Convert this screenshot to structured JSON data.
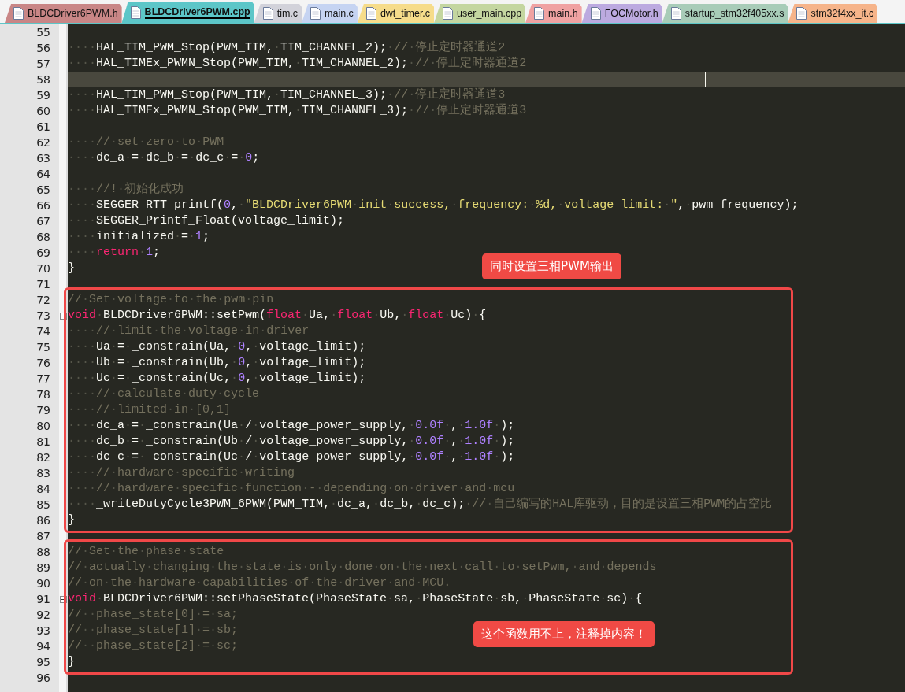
{
  "tabs": [
    {
      "label": "BLDCDriver6PWM.h",
      "selected": false,
      "color": "#c98686"
    },
    {
      "label": "BLDCDriver6PWM.cpp",
      "selected": true,
      "color": "#5cc6c8"
    },
    {
      "label": "tim.c",
      "selected": false,
      "color": "#d2d2da"
    },
    {
      "label": "main.c",
      "selected": false,
      "color": "#c6d4f2"
    },
    {
      "label": "dwt_timer.c",
      "selected": false,
      "color": "#f6dc8a"
    },
    {
      "label": "user_main.cpp",
      "selected": false,
      "color": "#c4d6a0"
    },
    {
      "label": "main.h",
      "selected": false,
      "color": "#f0a2a2"
    },
    {
      "label": "FOCMotor.h",
      "selected": false,
      "color": "#bcaae0"
    },
    {
      "label": "startup_stm32f405xx.s",
      "selected": false,
      "color": "#a8ccb8"
    },
    {
      "label": "stm32f4xx_it.c",
      "selected": false,
      "color": "#f6b48a"
    }
  ],
  "editor": {
    "sections": [
      {
        "kind": "plain",
        "lines": [
          {
            "number": "55"
          },
          {
            "number": "56",
            "tokens": [
              {
                "text": "····HAL_TIM_PWM_Stop(PWM_TIM,·TIM_CHANNEL_2);·",
                "kind": "plain"
              },
              {
                "text": "//·停止定时器通道2",
                "kind": "comment"
              }
            ]
          },
          {
            "number": "57",
            "tokens": [
              {
                "text": "····HAL_TIMEx_PWMN_Stop(PWM_TIM,·TIM_CHANNEL_2);·",
                "kind": "plain"
              },
              {
                "text": "//·停止定时器通道2",
                "kind": "comment"
              }
            ]
          },
          {
            "number": "58",
            "current": true
          },
          {
            "number": "59",
            "tokens": [
              {
                "text": "····HAL_TIM_PWM_Stop(PWM_TIM,·TIM_CHANNEL_3);·",
                "kind": "plain"
              },
              {
                "text": "//·停止定时器通道3",
                "kind": "comment"
              }
            ]
          },
          {
            "number": "60",
            "tokens": [
              {
                "text": "····HAL_TIMEx_PWMN_Stop(PWM_TIM,·TIM_CHANNEL_3);·",
                "kind": "plain"
              },
              {
                "text": "//·停止定时器通道3",
                "kind": "comment"
              }
            ]
          },
          {
            "number": "61"
          },
          {
            "number": "62",
            "tokens": [
              {
                "text": "····//·set·zero·to·PWM",
                "kind": "comment"
              }
            ]
          },
          {
            "number": "63",
            "tokens": [
              {
                "text": "····dc_a·=·dc_b·=·dc_c·=·",
                "kind": "plain"
              },
              {
                "text": "0",
                "kind": "number"
              },
              {
                "text": ";",
                "kind": "plain"
              }
            ]
          },
          {
            "number": "64"
          },
          {
            "number": "65",
            "tokens": [
              {
                "text": "····//!·初始化成功",
                "kind": "comment"
              }
            ]
          },
          {
            "number": "66",
            "tokens": [
              {
                "text": "····SEGGER_RTT_printf(",
                "kind": "plain"
              },
              {
                "text": "0",
                "kind": "number"
              },
              {
                "text": ",·",
                "kind": "plain"
              },
              {
                "text": "\"BLDCDriver6PWM·init·success,·frequency:·%d,·voltage_limit:·\"",
                "kind": "string"
              },
              {
                "text": ",·pwm_frequency);",
                "kind": "plain"
              }
            ]
          },
          {
            "number": "67",
            "tokens": [
              {
                "text": "····SEGGER_Printf_Float(voltage_limit);",
                "kind": "plain"
              }
            ]
          },
          {
            "number": "68",
            "tokens": [
              {
                "text": "····initialized·=·",
                "kind": "plain"
              },
              {
                "text": "1",
                "kind": "number"
              },
              {
                "text": ";",
                "kind": "plain"
              }
            ]
          },
          {
            "number": "69",
            "tokens": [
              {
                "text": "····",
                "kind": "plain"
              },
              {
                "text": "return",
                "kind": "keyword"
              },
              {
                "text": "·",
                "kind": "plain"
              },
              {
                "text": "1",
                "kind": "number"
              },
              {
                "text": ";",
                "kind": "plain"
              }
            ]
          },
          {
            "number": "70",
            "tokens": [
              {
                "text": "}",
                "kind": "plain"
              }
            ]
          },
          {
            "number": "71"
          }
        ]
      },
      {
        "kind": "frame",
        "lines": [
          {
            "number": "72",
            "tokens": [
              {
                "text": "//·Set·voltage·to·the·pwm·pin",
                "kind": "comment"
              }
            ]
          },
          {
            "number": "73",
            "fold": true,
            "tokens": [
              {
                "text": "void",
                "kind": "keyword"
              },
              {
                "text": "·BLDCDriver6PWM::setPwm(",
                "kind": "plain"
              },
              {
                "text": "float",
                "kind": "keyword"
              },
              {
                "text": "·Ua,·",
                "kind": "plain"
              },
              {
                "text": "float",
                "kind": "keyword"
              },
              {
                "text": "·Ub,·",
                "kind": "plain"
              },
              {
                "text": "float",
                "kind": "keyword"
              },
              {
                "text": "·Uc)·{",
                "kind": "plain"
              }
            ]
          },
          {
            "number": "74",
            "tokens": [
              {
                "text": "····//·limit·the·voltage·in·driver",
                "kind": "comment"
              }
            ]
          },
          {
            "number": "75",
            "tokens": [
              {
                "text": "····Ua·=·_constrain(Ua,·",
                "kind": "plain"
              },
              {
                "text": "0",
                "kind": "number"
              },
              {
                "text": ",·voltage_limit);",
                "kind": "plain"
              }
            ]
          },
          {
            "number": "76",
            "tokens": [
              {
                "text": "····Ub·=·_constrain(Ub,·",
                "kind": "plain"
              },
              {
                "text": "0",
                "kind": "number"
              },
              {
                "text": ",·voltage_limit);",
                "kind": "plain"
              }
            ]
          },
          {
            "number": "77",
            "tokens": [
              {
                "text": "····Uc·=·_constrain(Uc,·",
                "kind": "plain"
              },
              {
                "text": "0",
                "kind": "number"
              },
              {
                "text": ",·voltage_limit);",
                "kind": "plain"
              }
            ]
          },
          {
            "number": "78",
            "tokens": [
              {
                "text": "····//·calculate·duty·cycle",
                "kind": "comment"
              }
            ]
          },
          {
            "number": "79",
            "tokens": [
              {
                "text": "····//·limited·in·[0,1]",
                "kind": "comment"
              }
            ]
          },
          {
            "number": "80",
            "tokens": [
              {
                "text": "····dc_a·=·_constrain(Ua·/·voltage_power_supply,·",
                "kind": "plain"
              },
              {
                "text": "0.0f",
                "kind": "number"
              },
              {
                "text": "·,·",
                "kind": "plain"
              },
              {
                "text": "1.0f",
                "kind": "number"
              },
              {
                "text": "·);",
                "kind": "plain"
              }
            ]
          },
          {
            "number": "81",
            "tokens": [
              {
                "text": "····dc_b·=·_constrain(Ub·/·voltage_power_supply,·",
                "kind": "plain"
              },
              {
                "text": "0.0f",
                "kind": "number"
              },
              {
                "text": "·,·",
                "kind": "plain"
              },
              {
                "text": "1.0f",
                "kind": "number"
              },
              {
                "text": "·);",
                "kind": "plain"
              }
            ]
          },
          {
            "number": "82",
            "tokens": [
              {
                "text": "····dc_c·=·_constrain(Uc·/·voltage_power_supply,·",
                "kind": "plain"
              },
              {
                "text": "0.0f",
                "kind": "number"
              },
              {
                "text": "·,·",
                "kind": "plain"
              },
              {
                "text": "1.0f",
                "kind": "number"
              },
              {
                "text": "·);",
                "kind": "plain"
              }
            ]
          },
          {
            "number": "83",
            "tokens": [
              {
                "text": "····//·hardware·specific·writing",
                "kind": "comment"
              }
            ]
          },
          {
            "number": "84",
            "tokens": [
              {
                "text": "····//·hardware·specific·function·-·depending·on·driver·and·mcu",
                "kind": "comment"
              }
            ]
          },
          {
            "number": "85",
            "tokens": [
              {
                "text": "····_writeDutyCycle3PWM_6PWM(PWM_TIM,·dc_a,·dc_b,·dc_c);·",
                "kind": "plain"
              },
              {
                "text": "//·自己编写的HAL库驱动，目的是设置三相PWM的占空比",
                "kind": "comment"
              }
            ]
          },
          {
            "number": "86",
            "tokens": [
              {
                "text": "}",
                "kind": "plain"
              }
            ]
          }
        ]
      },
      {
        "kind": "plain",
        "lines": [
          {
            "number": "87"
          }
        ]
      },
      {
        "kind": "frame",
        "lines": [
          {
            "number": "88",
            "tokens": [
              {
                "text": "//·Set·the·phase·state",
                "kind": "comment"
              }
            ]
          },
          {
            "number": "89",
            "tokens": [
              {
                "text": "//·actually·changing·the·state·is·only·done·on·the·next·call·to·setPwm,·and·depends",
                "kind": "comment"
              }
            ]
          },
          {
            "number": "90",
            "tokens": [
              {
                "text": "//·on·the·hardware·capabilities·of·the·driver·and·MCU.",
                "kind": "comment"
              }
            ]
          },
          {
            "number": "91",
            "fold": true,
            "tokens": [
              {
                "text": "void",
                "kind": "keyword"
              },
              {
                "text": "·BLDCDriver6PWM::setPhaseState(PhaseState·sa,·PhaseState·sb,·PhaseState·sc)·{",
                "kind": "plain"
              }
            ]
          },
          {
            "number": "92",
            "tokens": [
              {
                "text": "//··phase_state[0]·=·sa;",
                "kind": "comment"
              }
            ]
          },
          {
            "number": "93",
            "tokens": [
              {
                "text": "//··phase_state[1]·=·sb;",
                "kind": "comment"
              }
            ]
          },
          {
            "number": "94",
            "tokens": [
              {
                "text": "//··phase_state[2]·=·sc;",
                "kind": "comment"
              }
            ]
          },
          {
            "number": "95",
            "tokens": [
              {
                "text": "}",
                "kind": "plain"
              }
            ]
          }
        ]
      },
      {
        "kind": "plain",
        "lines": [
          {
            "number": "96"
          }
        ]
      }
    ]
  },
  "callouts": [
    {
      "text": "同时设置三相PWM输出"
    },
    {
      "text": "这个函数用不上，注释掉内容！"
    }
  ]
}
